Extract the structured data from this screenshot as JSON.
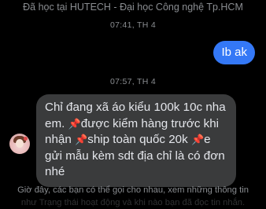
{
  "header": {
    "caption": "Đã học tại HUTECH - Đại học Công nghệ Tp.HCM"
  },
  "thread": {
    "timestamp_1": "07:41, TH 4",
    "outgoing_message": "Ib ak",
    "timestamp_2": "07:57, TH 4",
    "incoming_message": {
      "line1": "Chỉ đang xã áo kiểu 100k 10c nha em.",
      "part2": "được kiểm hàng trước khi nhận",
      "part3": "ship toàn quốc 20k",
      "part4": "e gửi mẫu kèm sdt địa chỉ là có đơn nhé"
    },
    "pin_icon": "pushpin-icon"
  },
  "footer": {
    "notice_line1": "Giờ đây, các bạn có thể gọi cho nhau, xem những thông tin",
    "notice_line2": "như Trạng thái hoạt động và khi nào bạn đã đọc tin nhắn."
  },
  "colors": {
    "background": "#000000",
    "outgoing_bubble": "#3478f6",
    "incoming_bubble": "#3a3b3c",
    "muted_text": "#8a8d91"
  }
}
